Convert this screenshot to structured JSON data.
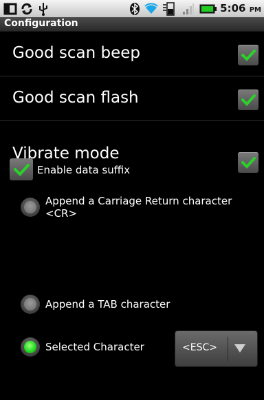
{
  "status_bar": {
    "time": "5:06",
    "ampm": "PM",
    "icons": [
      "notification-icon",
      "sync-icon",
      "usb-icon",
      "bluetooth-icon",
      "wifi-icon",
      "cell-data-icon",
      "signal-icon",
      "battery-icon"
    ]
  },
  "title": "Configuration",
  "preferences": [
    {
      "label": "Good scan beep",
      "checked": true
    },
    {
      "label": "Good scan flash",
      "checked": true
    },
    {
      "label": "Vibrate mode",
      "checked": true
    }
  ],
  "enable_suffix": {
    "label": "Enable data suffix",
    "checked": true
  },
  "suffix_options": {
    "cr_line1": "Append a Carriage Return character",
    "cr_line2": "<CR>",
    "tab": "Append a TAB character",
    "selected": "Selected Character",
    "selected_index": 2
  },
  "character_select": {
    "value": "<ESC>"
  },
  "colors": {
    "check_green": "#2ad22a",
    "radio_on": "#22dd22"
  }
}
